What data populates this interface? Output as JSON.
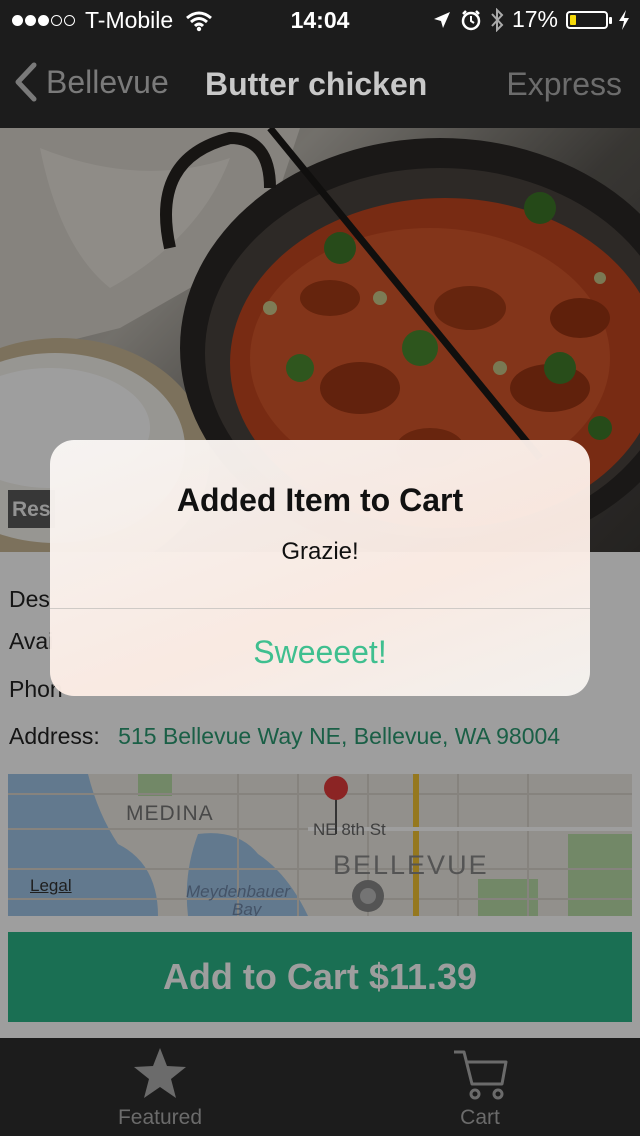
{
  "status_bar": {
    "carrier": "T-Mobile",
    "time": "14:04",
    "battery_percent": "17%",
    "battery_level": 0.17,
    "signal_bars_filled": 3,
    "signal_bars_total": 5,
    "icons": [
      "wifi-icon",
      "location-arrow-icon",
      "alarm-icon",
      "bluetooth-icon",
      "battery-icon",
      "charging-bolt-icon"
    ]
  },
  "nav": {
    "back_label": "Bellevue",
    "title": "Butter chicken",
    "right_label": "Express"
  },
  "hero": {
    "badge_text": "Res"
  },
  "details": {
    "description_label": "Des",
    "availability_label": "Avai",
    "phone_label": "Phon",
    "address_label": "Address:",
    "address_value": "515 Bellevue Way NE, Bellevue, WA 98004"
  },
  "map": {
    "label_medina": "MEDINA",
    "label_street": "NE 8th St",
    "label_bellevue": "BELLEVUE",
    "label_meydenbauer": "Meydenbauer",
    "label_bay": "Bay",
    "legal": "Legal"
  },
  "cta": {
    "label": "Add to Cart $11.39"
  },
  "tabs": [
    {
      "label": "Featured",
      "icon": "star-icon"
    },
    {
      "label": "Cart",
      "icon": "cart-icon"
    }
  ],
  "alert": {
    "title": "Added Item to Cart",
    "message": "Grazie!",
    "button": "Sweeeet!"
  },
  "colors": {
    "accent_green": "#2bb386",
    "link_green": "#2a9a72",
    "alert_button": "#3fbf8f",
    "bar_dark": "#1c1c1c"
  }
}
